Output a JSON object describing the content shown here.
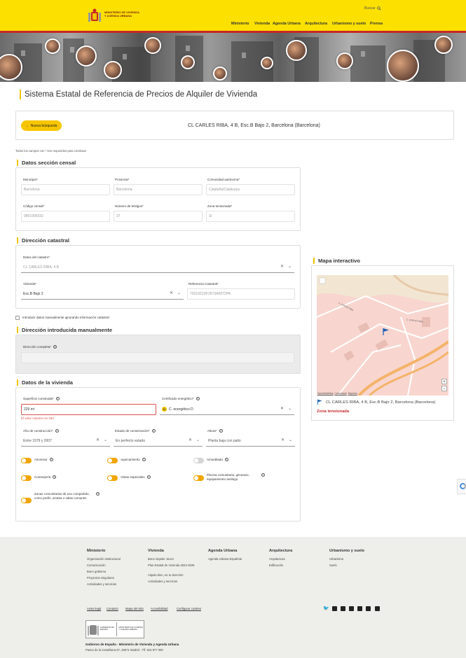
{
  "header": {
    "logo_text": "MINISTERIO DE VIVIENDA Y AGENDA URBANA",
    "search_label": "Buscar",
    "nav": [
      "Ministerio",
      "Vivienda",
      "Agenda Urbana",
      "Arquitectura",
      "Urbanismo y suelo",
      "Prensa"
    ]
  },
  "page": {
    "title": "Sistema Estatal de Referencia de Precios de Alquiler de Vivienda",
    "new_search_label": "Nueva búsqueda",
    "address": "CL CARLES RIBA, 4 B, Esc.B Bajo 2, Barcelona (Barcelona)",
    "required_note": "Todos los campos con * son requeridos para continuar"
  },
  "census": {
    "title": "Datos sección censal",
    "municipio_label": "Municipio*",
    "municipio": "Barcelona",
    "provincia_label": "Provincia*",
    "provincia": "Barcelona",
    "comunidad_label": "Comunidad autónoma*",
    "comunidad": "Cataluña/Catalunya",
    "codigo_label": "Código censal*",
    "codigo": "0801905032",
    "testigos_label": "Número de testigos*",
    "testigos": "37",
    "zona_label": "Zona tensionada*",
    "zona": "Si"
  },
  "cadastral": {
    "title": "Dirección catastral",
    "catastro_label": "Datos del catastro*",
    "catastro": "CL CARLES RIBA, 4 B",
    "vivienda_label": "Vivienda*",
    "vivienda": "Esc.B Bajo 2",
    "ref_label": "Referencia Catastral*",
    "ref": "7031921DF2873A0072PA",
    "manual_checkbox_label": "Introducir datos manualmente ignorando información catastral"
  },
  "manual": {
    "title": "Dirección introducida manualmente",
    "label": "Dirección completa*"
  },
  "housing": {
    "title": "Datos de la vivienda",
    "superficie_label": "Superficie construida*",
    "superficie": "229  m²",
    "superficie_error": "El valor máximo es 150",
    "certificado_label": "Certificado energético*",
    "certificado_badge": "D",
    "certificado": "C. energético D",
    "anio_label": "Año de construcción*",
    "anio": "Entre 1979 y 2007",
    "estado_label": "Estado de conservación*",
    "estado": "En perfecto estado",
    "altura_label": "Altura*",
    "altura": "Planta baja con patio",
    "toggles": [
      {
        "label": "Ascensor",
        "on": true
      },
      {
        "label": "Aparcamiento",
        "on": true
      },
      {
        "label": "Amueblada",
        "on": false
      },
      {
        "label": "Conserjería",
        "on": true
      },
      {
        "label": "Vistas especiales",
        "on": true
      },
      {
        "label": "Piscina comunitaria, gimnasio, equipamiento análogo",
        "on": true
      },
      {
        "label": "Zonas comunitarias de uso compartido, como jardín, azotea o salas comunes",
        "on": true
      }
    ]
  },
  "map": {
    "title": "Mapa interactivo",
    "attribution_a": "OpenStreetMap",
    "attribution_b": "Cartociudad",
    "attribution_c": "MapLibre",
    "street_a": "C. CARLES RIBA",
    "street_b": "C. CARLES RIBA",
    "zoom_in": "+",
    "zoom_out": "−",
    "address": "CL CARLES RIBA, 4 B, Esc.B Bajo 2, Barcelona (Barcelona)",
    "zona_label": "Zona tensionada"
  },
  "footer": {
    "cols": [
      {
        "title": "Ministerio",
        "items": [
          "Organización institucional",
          "Comunicación",
          "Buen gobierno",
          "Proyectos singulares",
          "Actividades y servicios"
        ]
      },
      {
        "title": "Vivienda",
        "items": [
          "Bono Alquiler Joven",
          "Plan Estatal de Vivienda 2022-2025",
          "Alquila bien, es tu derecho!",
          "Actividades y servicios"
        ]
      },
      {
        "title": "Agenda Urbana",
        "items": [
          "Agenda Urbana Española"
        ]
      },
      {
        "title": "Arquitectura",
        "items": [
          "Arquitectura",
          "Edificación"
        ]
      },
      {
        "title": "Urbanismo y suelo",
        "items": [
          "Urbanismo",
          "Suelo"
        ]
      }
    ],
    "links": [
      "Aviso legal",
      "Contacto",
      "Mapa del sitio",
      "Accesibilidad",
      "Configurar cookies"
    ],
    "gov_logo_a": "GOBIERNO DE ESPAÑA",
    "gov_logo_b": "MINISTERIO DE VIVIENDA Y AGENDA URBANA",
    "org": "Gobierno de España - Ministerio de Vivienda y Agenda Urbana",
    "address": "Paseo de la Castellana 67, 28071 Madrid - Tlf. 915 977 000"
  }
}
